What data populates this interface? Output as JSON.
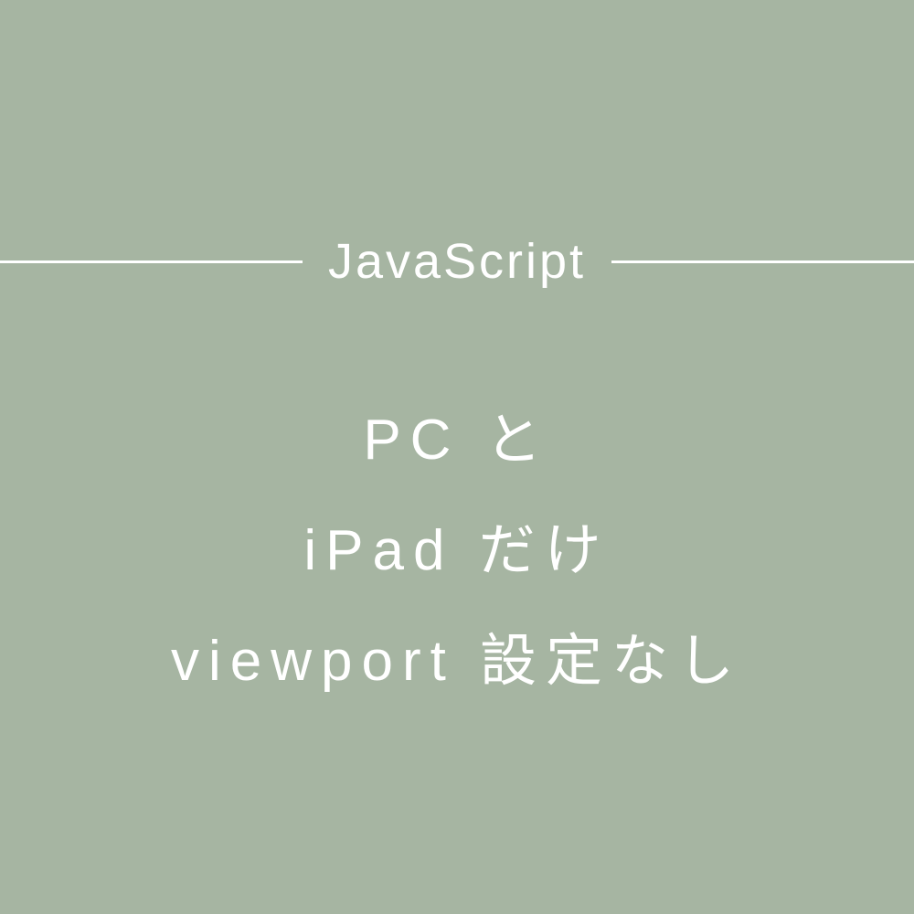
{
  "heading": {
    "category": "JavaScript"
  },
  "body": {
    "line1": "PC と",
    "line2": "iPad だけ",
    "line3": "viewport 設定なし"
  },
  "colors": {
    "background": "#a6b5a2",
    "text": "#ffffff"
  }
}
